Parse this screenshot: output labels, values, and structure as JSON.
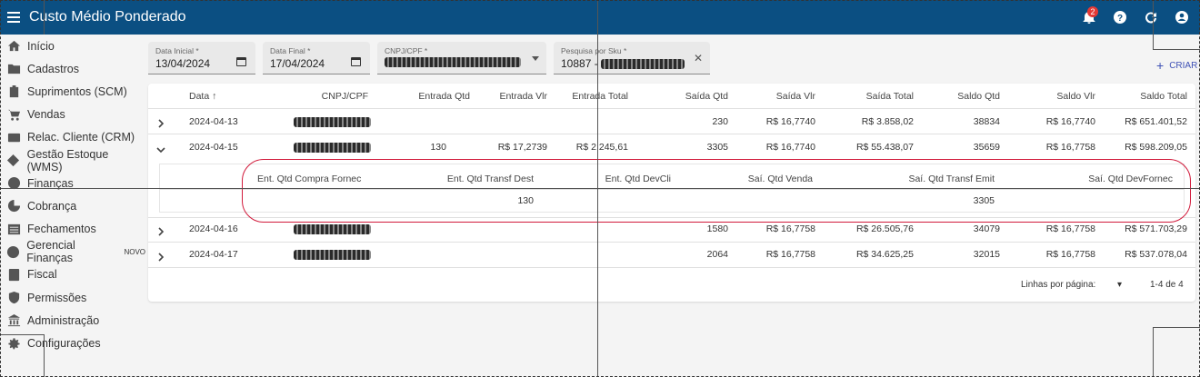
{
  "header": {
    "title": "Custo Médio Ponderado",
    "notification_count": "2",
    "icons": [
      "menu-icon",
      "bell-icon",
      "help-icon",
      "refresh-icon",
      "account-icon"
    ]
  },
  "sidebar": {
    "items": [
      {
        "label": "Início",
        "icon": "home-icon"
      },
      {
        "label": "Cadastros",
        "icon": "folder-icon"
      },
      {
        "label": "Suprimentos (SCM)",
        "icon": "clipboard-icon"
      },
      {
        "label": "Vendas",
        "icon": "cart-icon"
      },
      {
        "label": "Relac. Cliente (CRM)",
        "icon": "contact-card-icon"
      },
      {
        "label": "Gestão Estoque (WMS)",
        "icon": "diamond-arrow-icon"
      },
      {
        "label": "Finanças",
        "icon": "dollar-icon"
      },
      {
        "label": "Cobrança",
        "icon": "pie-icon"
      },
      {
        "label": "Fechamentos",
        "icon": "list-icon"
      },
      {
        "label": "Gerencial Finanças",
        "badge": "NOVO",
        "icon": "dollar-icon"
      },
      {
        "label": "Fiscal",
        "icon": "book-icon"
      },
      {
        "label": "Permissões",
        "icon": "shield-icon"
      },
      {
        "label": "Administração",
        "icon": "bank-icon"
      },
      {
        "label": "Configurações",
        "icon": "gear-icon"
      }
    ]
  },
  "filters": {
    "data_inicial": {
      "label": "Data Inicial *",
      "value": "13/04/2024"
    },
    "data_final": {
      "label": "Data Final *",
      "value": "17/04/2024"
    },
    "cnpj": {
      "label": "CNPJ/CPF *"
    },
    "sku": {
      "label": "Pesquisa por Sku *",
      "value_prefix": "10887 -"
    }
  },
  "actions": {
    "criar": "CRIAR"
  },
  "table": {
    "headers": [
      "Data",
      "CNPJ/CPF",
      "Entrada Qtd",
      "Entrada Vlr",
      "Entrada Total",
      "Saída Qtd",
      "Saída Vlr",
      "Saída Total",
      "Saldo Qtd",
      "Saldo Vlr",
      "Saldo Total"
    ],
    "sort_icon": "arrow-up-icon",
    "rows": [
      {
        "data": "2024-04-13",
        "entrada_qtd": "",
        "entrada_vlr": "",
        "entrada_total": "",
        "saida_qtd": "230",
        "saida_vlr": "R$ 16,7740",
        "saida_total": "R$ 3.858,02",
        "saldo_qtd": "38834",
        "saldo_vlr": "R$ 16,7740",
        "saldo_total": "R$ 651.401,52"
      },
      {
        "data": "2024-04-15",
        "entrada_qtd": "130",
        "entrada_vlr": "R$ 17,2739",
        "entrada_total": "R$ 2.245,61",
        "saida_qtd": "3305",
        "saida_vlr": "R$ 16,7740",
        "saida_total": "R$ 55.438,07",
        "saldo_qtd": "35659",
        "saldo_vlr": "R$ 16,7758",
        "saldo_total": "R$ 598.209,05"
      },
      {
        "data": "2024-04-16",
        "entrada_qtd": "",
        "entrada_vlr": "",
        "entrada_total": "",
        "saida_qtd": "1580",
        "saida_vlr": "R$ 16,7758",
        "saida_total": "R$ 26.505,76",
        "saldo_qtd": "34079",
        "saldo_vlr": "R$ 16,7758",
        "saldo_total": "R$ 571.703,29"
      },
      {
        "data": "2024-04-17",
        "entrada_qtd": "",
        "entrada_vlr": "",
        "entrada_total": "",
        "saida_qtd": "2064",
        "saida_vlr": "R$ 16,7758",
        "saida_total": "R$ 34.625,25",
        "saldo_qtd": "32015",
        "saldo_vlr": "R$ 16,7758",
        "saldo_total": "R$ 537.078,04"
      }
    ],
    "detail": {
      "headers": [
        "Ent. Qtd Compra Fornec",
        "Ent. Qtd Transf Dest",
        "Ent. Qtd DevCli",
        "Saí. Qtd Venda",
        "Saí. Qtd Transf Emit",
        "Saí. Qtd DevFornec"
      ],
      "values": [
        "",
        "130",
        "",
        "",
        "3305",
        ""
      ]
    }
  },
  "pagination": {
    "label": "Linhas por página:",
    "range": "1-4 de 4"
  },
  "colors": {
    "header_bg": "#0b4f82",
    "accent": "#3f51b5",
    "highlight": "#d11a3b"
  }
}
